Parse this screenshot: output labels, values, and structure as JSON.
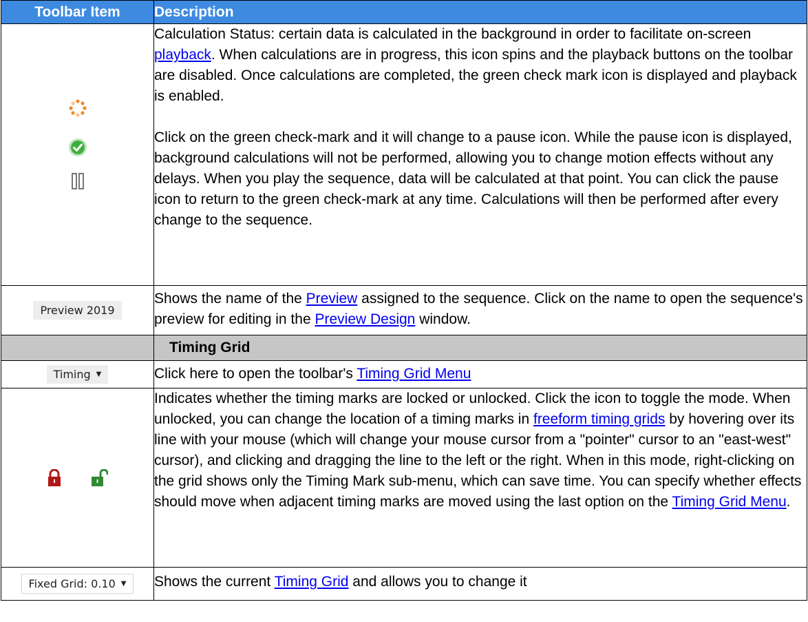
{
  "header": {
    "col_item": "Toolbar Item",
    "col_desc": "Description"
  },
  "rows": {
    "calc": {
      "icons": [
        "spinner-icon",
        "check-circle-icon",
        "pause-icon"
      ],
      "p1_a": "Calculation Status: certain data is calculated in the background in order to facilitate on-screen ",
      "p1_link": "playback",
      "p1_b": ". When calculations are in progress, this icon spins and the playback buttons on the toolbar are disabled. Once calculations are completed, the green check mark icon is displayed and playback is enabled.",
      "p2": "Click on the green check-mark and it will change to a pause icon. While the pause icon is displayed, background calculations will not be performed, allowing you to change motion effects without any delays. When you play the sequence, data will be calculated at that point. You can click the pause icon to return to the green check-mark at any time. Calculations will then be performed after every change to the sequence."
    },
    "preview": {
      "chip": "Preview 2019",
      "a": "Shows the name of the ",
      "link1": "Preview",
      "b": " assigned to the sequence. Click on the name to open the sequence's preview for editing in the ",
      "link2": "Preview Design",
      "c": " window."
    },
    "section": {
      "title": "Timing Grid"
    },
    "timing": {
      "chip": "Timing",
      "a": "Click here to open the toolbar's ",
      "link": "Timing Grid Menu"
    },
    "lock": {
      "icons": [
        "lock-icon",
        "unlock-icon"
      ],
      "a": "Indicates whether the timing marks are locked or unlocked. Click the icon to toggle the mode. When unlocked, you can change the location of a timing marks in ",
      "link1": "freeform timing grids",
      "b": " by hovering over its line with your mouse (which will change your mouse cursor from a \"pointer\" cursor to an \"east-west\" cursor), and clicking and dragging the line to the left or the right. When in this mode, right-clicking on the grid shows only the Timing Mark sub-menu, which can save time. You can specify whether effects should move when adjacent timing marks are moved using the last option on the ",
      "link2": "Timing Grid Menu",
      "c": "."
    },
    "fixed": {
      "chip": "Fixed Grid: 0.10",
      "a": "Shows the current ",
      "link": "Timing Grid",
      "b": " and allows you to change it"
    }
  },
  "colors": {
    "header_bg": "#3d8ae0",
    "section_bg": "#c6c6c6",
    "link": "#0000ee",
    "spinner": "#f08a24",
    "check_green": "#3fae3f",
    "lock_red": "#b01818",
    "unlock_green": "#2f8a2f"
  }
}
